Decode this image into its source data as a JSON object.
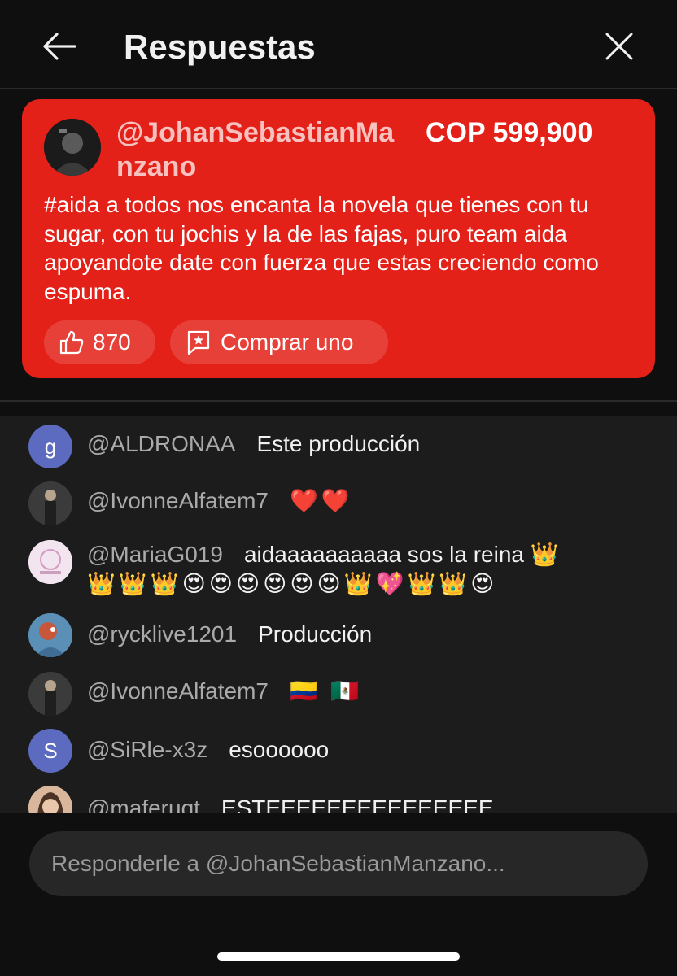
{
  "header": {
    "title": "Respuestas",
    "back_icon": "arrow-left-icon",
    "close_icon": "close-icon"
  },
  "superchat": {
    "author": "@JohanSebastianManzano",
    "amount": "COP 599,900",
    "message": "#aida a todos nos encanta la novela que tienes con tu sugar, con tu jochis y la de las fajas, puro team aida apoyandote date con fuerza que estas creciendo como espuma.",
    "like_count": "870",
    "buy_label": "Comprar uno",
    "background_color": "#e32119"
  },
  "chat": {
    "messages": [
      {
        "author": "@ALDRONAA",
        "text": "Este producción",
        "avatar_letter": "g",
        "avatar_color": "#5c6bc0"
      },
      {
        "author": "@IvonneAlfatem7",
        "text": "❤️❤️"
      },
      {
        "author": "@MariaG019",
        "text": "aidaaaaaaaaaa sos la reina 👑",
        "text_line2": "👑👑👑😍😍😍😍😍😍👑💖👑👑😍"
      },
      {
        "author": "@rycklive1201",
        "text": "Producción"
      },
      {
        "author": "@IvonneAlfatem7",
        "text": "🇨🇴 🇲🇽"
      },
      {
        "author": "@SiRle-x3z",
        "text": "esoooooo",
        "avatar_letter": "S",
        "avatar_color": "#5c6bc0"
      },
      {
        "author": "@maferugt",
        "text": "ESTEEEEEEEEEEEEEEE"
      }
    ]
  },
  "reply": {
    "placeholder": "Responderle a @JohanSebastianManzano..."
  }
}
